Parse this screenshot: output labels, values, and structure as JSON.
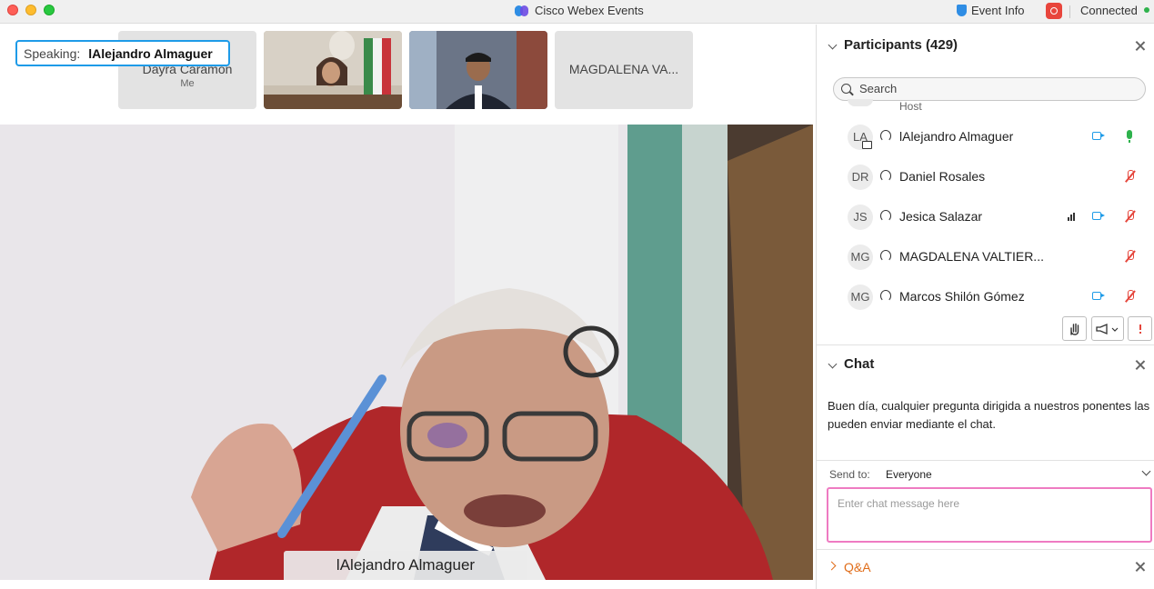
{
  "window": {
    "app_title": "Cisco Webex Events",
    "event_info": "Event Info",
    "status": "Connected"
  },
  "speaking": {
    "label": "Speaking:",
    "name": "lAlejandro Almaguer"
  },
  "thumbnails": [
    {
      "name": "Dayra Caramón",
      "sub": "Me"
    },
    {
      "name": "",
      "sub": ""
    },
    {
      "name": "",
      "sub": ""
    },
    {
      "name": "MAGDALENA VA...",
      "sub": ""
    }
  ],
  "main_video": {
    "name": "lAlejandro Almaguer"
  },
  "participants": {
    "title": "Participants (429)",
    "search_placeholder": "Search",
    "host_label": "Host",
    "rows": [
      {
        "initials": "LA",
        "name": "lAlejandro Almaguer",
        "video": true,
        "muted": false,
        "sharing": true
      },
      {
        "initials": "DR",
        "name": "Daniel Rosales",
        "video": false,
        "muted": true
      },
      {
        "initials": "JS",
        "name": "Jesica Salazar",
        "video": true,
        "muted": true,
        "signal": true
      },
      {
        "initials": "MG",
        "name": "MAGDALENA VALTIER...",
        "video": false,
        "muted": true
      },
      {
        "initials": "MG",
        "name": "Marcos Shilón Gómez",
        "video": true,
        "muted": true
      }
    ]
  },
  "chat": {
    "title": "Chat",
    "message": "Buen día, cualquier pregunta dirigida a nuestros ponentes las pueden enviar mediante el chat.",
    "send_to_label": "Send to:",
    "send_to_value": "Everyone",
    "input_placeholder": "Enter chat message here"
  },
  "qa": {
    "title": "Q&A"
  },
  "colors": {
    "accent_blue": "#1e9be8",
    "chat_focus": "#ee7bc2",
    "muted_red": "#e5453b",
    "qa_orange": "#e06d1a"
  }
}
